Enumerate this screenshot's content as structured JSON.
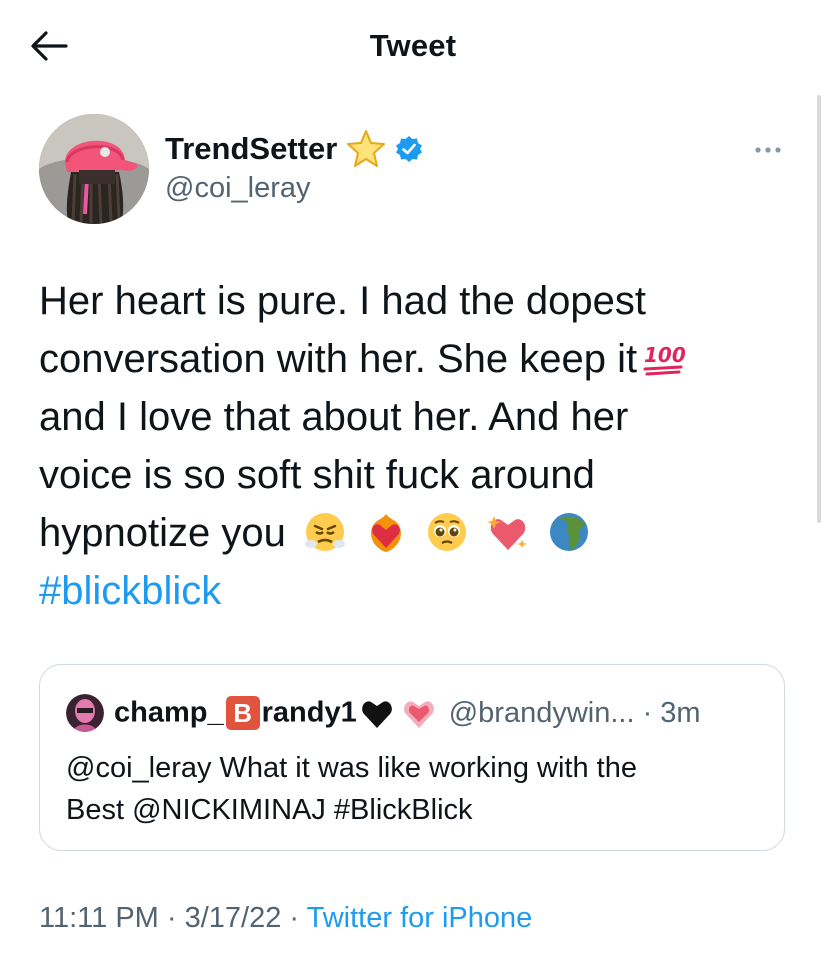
{
  "header": {
    "title": "Tweet",
    "back_icon": "arrow-left-icon"
  },
  "author": {
    "display_name": "TrendSetter",
    "handle": "@coi_leray",
    "name_emoji": "star-icon",
    "verified_icon": "verified-badge-icon"
  },
  "tweet": {
    "lines": [
      "Her heart is pure. I had the dopest",
      "conversation with her. She keep it",
      "and I love that about her. And her",
      "voice is so soft shit fuck around",
      "hypnotize you"
    ],
    "inline_emoji": "hundred-points-icon",
    "trailing_emojis": [
      "steam-from-nose-icon",
      "heart-on-fire-icon",
      "pleading-face-icon",
      "sparkling-heart-icon",
      "globe-americas-icon"
    ],
    "hashtag": "#blickblick"
  },
  "quote": {
    "name_part1": "champ_",
    "name_b": "B",
    "name_part2": "randy1",
    "name_emojis": [
      "black-heart-icon",
      "pink-heart-icon"
    ],
    "handle_time": "@brandywin... · 3m",
    "body_lines": [
      "@coi_leray What it was like working with the",
      "Best @NICKIMINAJ #BlickBlick"
    ]
  },
  "meta": {
    "timestamp": "11:11 PM · 3/17/22 · ",
    "source": "Twitter for iPhone"
  },
  "colors": {
    "link": "#1d9bf0",
    "secondary_text": "#536471",
    "border": "#cfd9de",
    "verified": "#1d9bf0"
  }
}
